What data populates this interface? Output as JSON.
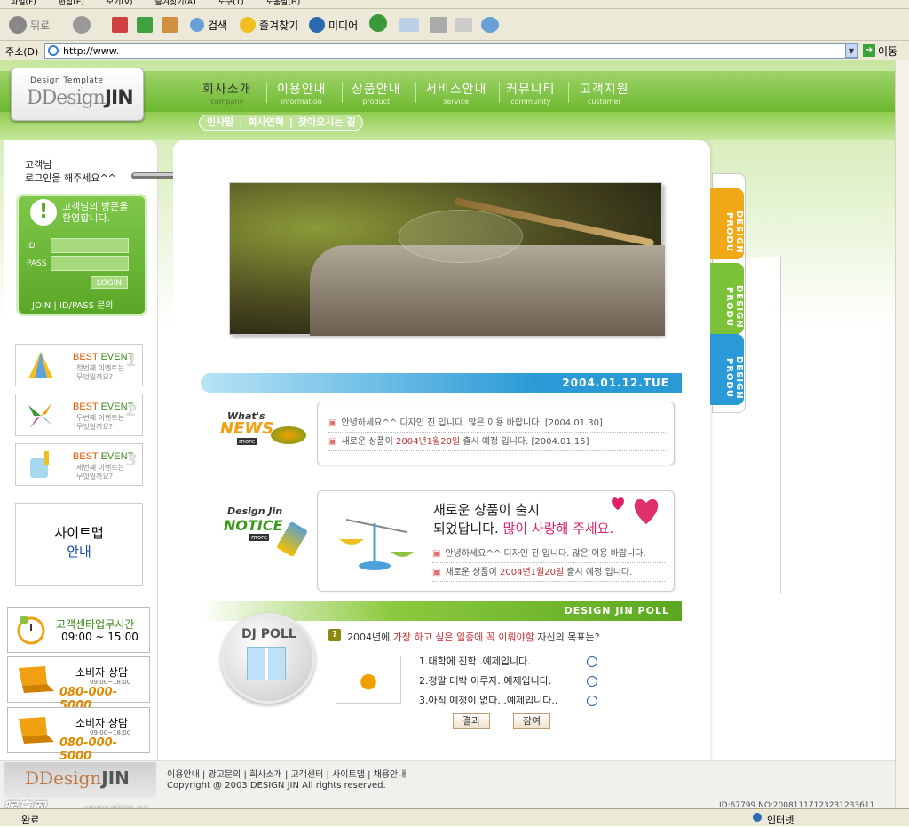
{
  "browser": {
    "menu": [
      "파일(F)",
      "편집(E)",
      "보기(V)",
      "즐겨찾기(A)",
      "도구(T)",
      "도움말(H)"
    ],
    "toolbar": {
      "back": "뒤로",
      "search": "검색",
      "favorites": "즐겨찾기",
      "media": "미디어"
    },
    "address_label": "주소(D)",
    "address_value": "http://www.",
    "go_label": "이동",
    "status_left": "완료",
    "status_zone": "인터넷"
  },
  "site": {
    "logo_tag": "Design Template",
    "logo_main_a": "DDesign",
    "logo_main_b": "JIN",
    "nav": [
      {
        "k": "회사소개",
        "e": "company"
      },
      {
        "k": "이용안내",
        "e": "information"
      },
      {
        "k": "상품안내",
        "e": "product"
      },
      {
        "k": "서비스안내",
        "e": "service"
      },
      {
        "k": "커뮤니티",
        "e": "community"
      },
      {
        "k": "고객지원",
        "e": "customer"
      }
    ],
    "subnav": [
      "인사말",
      "|",
      "회사연혁",
      "|",
      "찾아오시는 길"
    ]
  },
  "login": {
    "greet1": "고객님",
    "greet2": "로그인을 해주세요^^",
    "welcome1": "고객님의 방문을",
    "welcome2": "환영합니다.",
    "id_label": "ID",
    "pass_label": "PASS",
    "button": "LOGIN",
    "links": "JOIN  |  ID/PASS 문의"
  },
  "events": [
    {
      "title_a": "BEST ",
      "title_b": "EVENT",
      "sub1": "첫번째 이벤트는",
      "sub2": "무엇일까요?",
      "n": "1"
    },
    {
      "title_a": "BEST ",
      "title_b": "EVENT",
      "sub1": "두번째 이벤트는",
      "sub2": "무엇일까요?",
      "n": "2"
    },
    {
      "title_a": "BEST ",
      "title_b": "EVENT",
      "sub1": "세번째 이벤트는",
      "sub2": "무엇일까요?",
      "n": "3"
    }
  ],
  "sitemap": {
    "l1": "사이트맵",
    "l2": "안내"
  },
  "cs": {
    "hours_title": "고객센타업무시간",
    "hours_value": "09:00 ~ 15:00",
    "c1_title": "소비자 상담",
    "c1_hours": "09:00~18:00",
    "c1_phone": "080-000-5000",
    "c2_title": "소비자 상담",
    "c2_hours": "09:00~18:00",
    "c2_phone": "080-000-5000"
  },
  "side_tabs": [
    {
      "label": "DESIGN PRODU",
      "color": "#f0a818"
    },
    {
      "label": "DESIGN PRODU",
      "color": "#7cc238"
    },
    {
      "label": "DESIGN PRODU",
      "color": "#2a9ad6"
    }
  ],
  "date": "2004.01.12.TUE",
  "news": {
    "whats": "What's",
    "title": "NEWS",
    "more": "more",
    "items": [
      {
        "text": "안녕하세요^^ 디자인 진 입니다. 많은 이용 바랍니다. [2004.01.30]"
      },
      {
        "pre": "새로운 상품이 ",
        "em": "2004년1월20일",
        "post": " 출시 예정 입니다. [2004.01.15]"
      }
    ]
  },
  "notice": {
    "dj": "Design Jin",
    "title": "NOTICE",
    "more": "more",
    "head1": "새로운 상품이 출시",
    "head2a": "되었답니다. ",
    "head2b": "많이 사랑해 주세요.",
    "items": [
      {
        "text": "안녕하세요^^ 디자인 진 입니다. 많은 이용 바랍니다."
      },
      {
        "pre": "새로운 상품이 ",
        "em": "2004년1월20일",
        "post": " 출시 예정 입니다."
      }
    ]
  },
  "poll": {
    "bar": "DESIGN JIN  POLL",
    "circle": "DJ POLL",
    "q_pre": "2004년에 ",
    "q_em": "가장 하고 싶은 일중에 꼭 이뤄야할",
    "q_post": " 자신의 목표는?",
    "options": [
      "1.대학에 진학..예제입니다.",
      "2.정말 대박 이루자..예제입니다.",
      "3.아직 예정이 없다...예제입니다.."
    ],
    "result": "결과",
    "vote": "참여"
  },
  "footer": {
    "links": "이용안내  |  광고문의  |  회사소개  |  고객센터  |  사이트맵  |  채용안내",
    "copy": "Copyright @ 2003 DESIGN JIN  All rights reserved.",
    "logo_a": "DDesign",
    "logo_b": "JIN"
  },
  "watermark": {
    "brand": "昵享网",
    "url": "www.nipic.cn",
    "id": "ID:67799 NO:20081117123231233611"
  }
}
